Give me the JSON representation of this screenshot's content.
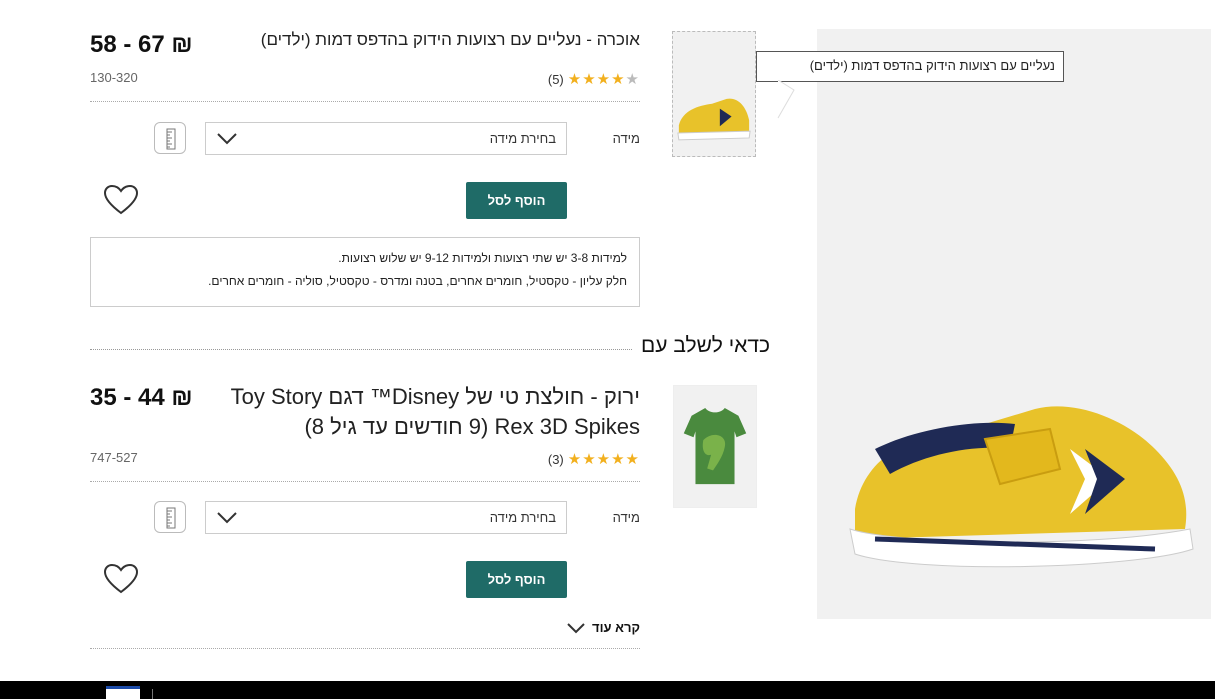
{
  "tooltip": {
    "text": "נעליים עם רצועות הידוק בהדפס דמות (ילדים)"
  },
  "product1": {
    "title": "אוכרה - נעליים עם רצועות הידוק בהדפס דמות (ילדים)",
    "price": "58 - 67 ₪",
    "sku": "130-320",
    "rating": {
      "stars": 4.5,
      "count": "(5)"
    },
    "size_label": "מידה",
    "size_select": "בחירת מידה",
    "add_to_bag": "הוסף לסל",
    "info_lines": [
      "למידות 3-8 יש שתי רצועות ולמידות 9-12 יש שלוש רצועות.",
      "חלק עליון - טקסטיל, חומרים אחרים, בטנה ומדרס - טקסטיל, סוליה - חומרים אחרים."
    ]
  },
  "section": {
    "title": "כדאי לשלב עם"
  },
  "product2": {
    "title": "ירוק - חולצת טי של Disney™ דגם Toy Story Rex 3D Spikes (9 חודשים עד גיל 8)",
    "price": "35 - 44 ₪",
    "sku": "747-527",
    "rating": {
      "stars": 5,
      "count": "(3)"
    },
    "size_label": "מידה",
    "size_select": "בחירת מידה",
    "add_to_bag": "הוסף לסל",
    "read_more": "קרא עוד"
  },
  "icons": {
    "heart": "heart-icon",
    "chevron": "chevron-down-icon",
    "ruler": "size-guide-icon",
    "flag": "israel-flag-icon"
  },
  "colors": {
    "accent": "#1f6b67",
    "star": "#f2b01e",
    "shoe": "#e8c22a",
    "footer": "#000000"
  }
}
